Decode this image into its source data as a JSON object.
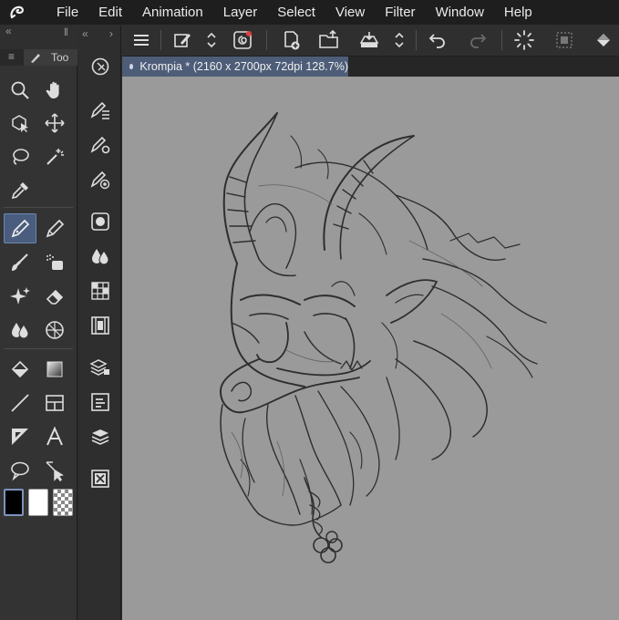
{
  "menu": {
    "items": [
      "File",
      "Edit",
      "Animation",
      "Layer",
      "Select",
      "View",
      "Filter",
      "Window",
      "Help"
    ]
  },
  "tool_palette": {
    "tab_label": "Too",
    "tools": [
      "zoom-icon",
      "hand-icon",
      "object-select-icon",
      "move-icon",
      "lasso-icon",
      "magic-wand-icon",
      "eyedropper-icon",
      "pen-icon",
      "pencil-icon",
      "brush-icon",
      "airbrush-icon",
      "sparkle-icon",
      "eraser-icon",
      "blend-icon",
      "grid-icon",
      "fill-icon",
      "gradient-icon",
      "line-icon",
      "frame-icon",
      "ruler-icon",
      "text-icon",
      "balloon-icon",
      "correct-line-icon"
    ],
    "active_tool": "pen-icon"
  },
  "colors": {
    "main": "#000000",
    "sub": "#ffffff",
    "accent": "#4a5d7e"
  },
  "document": {
    "tab_title": "Krompia * (2160 x 2700px 72dpi 128.7%)"
  }
}
